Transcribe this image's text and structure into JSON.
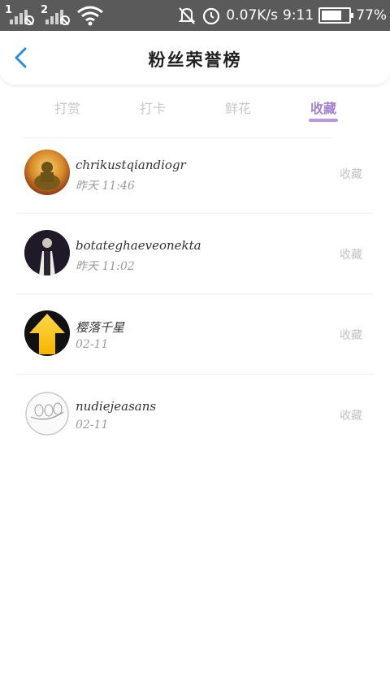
{
  "status_bar": {
    "sim1": "1",
    "sim2": "2",
    "net_speed": "0.07K/s",
    "time": "9:11",
    "battery": "77%",
    "battery_level": 0.77,
    "icons": [
      "signal-icon",
      "wifi-icon",
      "bell-off-icon",
      "alarm-icon",
      "battery-icon"
    ]
  },
  "header": {
    "title": "粉丝荣誉榜",
    "back_icon": "chevron-left-icon",
    "accent": "#2d8cd8"
  },
  "tabs": [
    {
      "label": "打赏",
      "active": false
    },
    {
      "label": "打卡",
      "active": false
    },
    {
      "label": "鲜花",
      "active": false
    },
    {
      "label": "收藏",
      "active": true
    }
  ],
  "colors": {
    "tab_active": "#a482cf",
    "tab_inactive": "#c8c8c8",
    "indicator": "#b896e0"
  },
  "list": [
    {
      "name": "chrikustqiandiogr",
      "time": "昨天 11:46",
      "action": "收藏"
    },
    {
      "name": "botateghaeveonekta",
      "time": "昨天 11:02",
      "action": "收藏"
    },
    {
      "name": "樱落千星",
      "time": "02-11",
      "action": "收藏"
    },
    {
      "name": "nudiejeasans",
      "time": "02-11",
      "action": "收藏"
    }
  ]
}
